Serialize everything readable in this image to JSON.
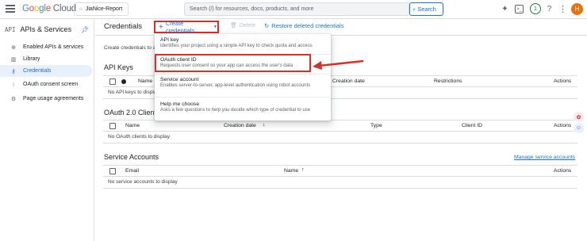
{
  "topbar": {
    "logo_google": "Google",
    "logo_cloud": "Cloud",
    "project": "JiaNice-Report",
    "search_placeholder": "Search (/) for resources, docs, products, and more",
    "search_button": "Search",
    "notifications_count": "1",
    "avatar_letter": "H"
  },
  "sidebar": {
    "api_glyph": "API",
    "title": "APIs & Services",
    "items": [
      {
        "label": "Enabled APIs & services",
        "icon": "grid-icon"
      },
      {
        "label": "Library",
        "icon": "library-icon"
      },
      {
        "label": "Credentials",
        "icon": "key-icon"
      },
      {
        "label": "OAuth consent screen",
        "icon": "consent-icon"
      },
      {
        "label": "Page usage agreements",
        "icon": "settings-icon"
      }
    ]
  },
  "header": {
    "title": "Credentials",
    "create_label": "Create credentials",
    "delete_label": "Delete",
    "restore_label": "Restore deleted credentials"
  },
  "intro_text": "Create credentials to a",
  "dropdown": {
    "items": [
      {
        "title": "API key",
        "desc": "Identifies your project using a simple API key to check quota and access"
      },
      {
        "title": "OAuth client ID",
        "desc": "Requests user consent so your app can access the user's data"
      },
      {
        "title": "Service account",
        "desc": "Enables server-to-server, app-level authentication using robot accounts"
      },
      {
        "title": "Help me choose",
        "desc": "Asks a few questions to help you decide which type of credential to use"
      }
    ]
  },
  "api_keys": {
    "title": "API Keys",
    "columns": {
      "name": "Name",
      "created": "Creation date",
      "restrictions": "Restrictions",
      "actions": "Actions"
    },
    "empty": "No API keys to display"
  },
  "oauth": {
    "title": "OAuth 2.0 Client I",
    "columns": {
      "name": "Name",
      "created": "Creation date",
      "type": "Type",
      "client_id": "Client ID",
      "actions": "Actions"
    },
    "empty": "No OAuth clients to display"
  },
  "service_accounts": {
    "title": "Service Accounts",
    "manage_link": "Manage service accounts",
    "columns": {
      "email": "Email",
      "name": "Name",
      "actions": "Actions"
    },
    "empty": "No service accounts to display"
  },
  "colors": {
    "accent": "#1a73e8",
    "highlight": "#d93025",
    "active_bg": "#e8f0fe"
  }
}
